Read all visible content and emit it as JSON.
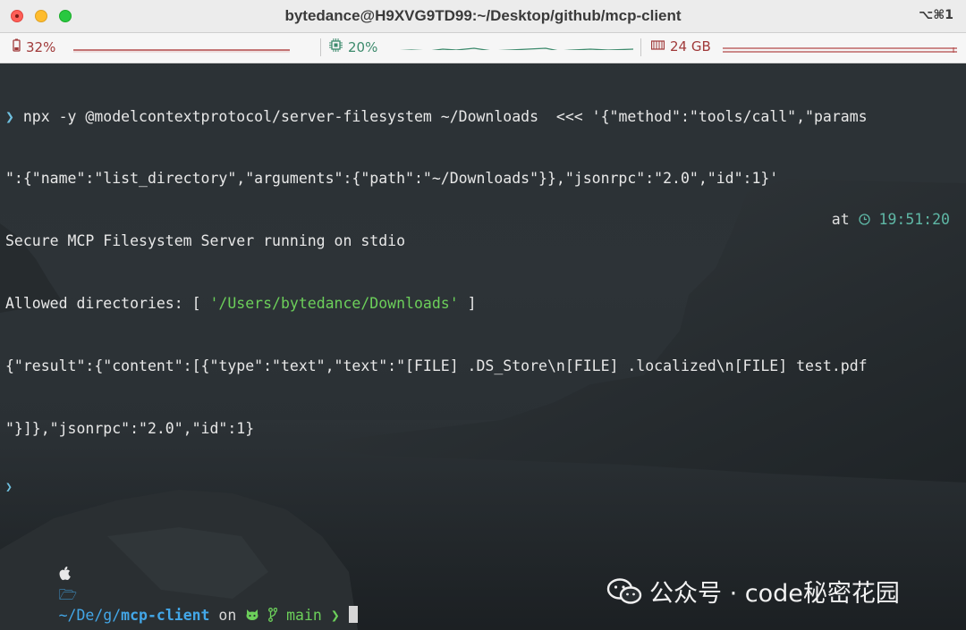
{
  "window": {
    "title": "bytedance@H9XVG9TD99:~/Desktop/github/mcp-client",
    "shortcut": "⌥⌘1"
  },
  "statusbar": {
    "battery": "32%",
    "cpu": "20%",
    "memory": "24 GB"
  },
  "terminal": {
    "line1": {
      "prompt": "❯",
      "command": " npx -y @modelcontextprotocol/server-filesystem ~/Downloads  <<< '{\"method\":\"tools/call\",\"params"
    },
    "line2": "\":{\"name\":\"list_directory\",\"arguments\":{\"path\":\"~/Downloads\"}},\"jsonrpc\":\"2.0\",\"id\":1}'",
    "line3": "Secure MCP Filesystem Server running on stdio",
    "line4": {
      "prefix": "Allowed directories: [ ",
      "path": "'/Users/bytedance/Downloads'",
      "suffix": " ]"
    },
    "line5": "{\"result\":{\"content\":[{\"type\":\"text\",\"text\":\"[FILE] .DS_Store\\n[FILE] .localized\\n[FILE] test.pdf",
    "line6": "\"}]},\"jsonrpc\":\"2.0\",\"id\":1}",
    "line7": "❯",
    "prompt": {
      "path_prefix": "~/De/g/",
      "dir": "mcp-client",
      "on": " on ",
      "branch": "main",
      "arrow": "❯",
      "at": "at",
      "time": "19:51:20"
    }
  },
  "watermark": "公众号 · code秘密花园"
}
